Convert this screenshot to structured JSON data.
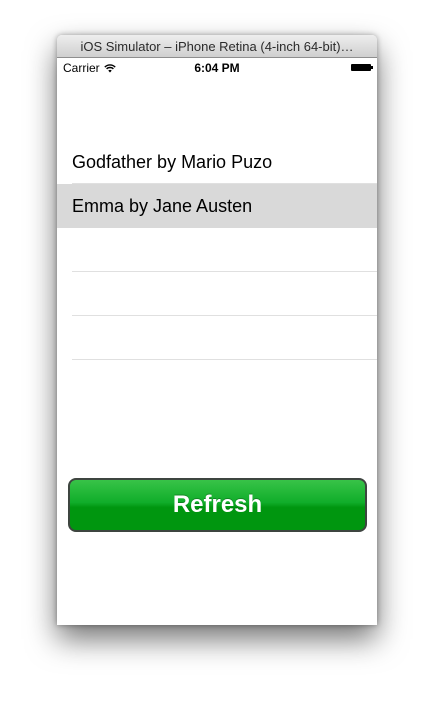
{
  "window": {
    "title": "iOS Simulator – iPhone Retina (4-inch 64-bit)…"
  },
  "statusbar": {
    "carrier": "Carrier",
    "time": "6:04 PM",
    "wifi_icon": "wifi-icon",
    "battery_icon": "battery-icon"
  },
  "table": {
    "rows": [
      {
        "label": "Godfather by Mario Puzo",
        "selected": false
      },
      {
        "label": "Emma by Jane Austen",
        "selected": true
      },
      {
        "label": "",
        "selected": false
      },
      {
        "label": "",
        "selected": false
      },
      {
        "label": "",
        "selected": false
      },
      {
        "label": "",
        "selected": false
      }
    ]
  },
  "button": {
    "refresh_label": "Refresh",
    "color": "#00960f"
  }
}
